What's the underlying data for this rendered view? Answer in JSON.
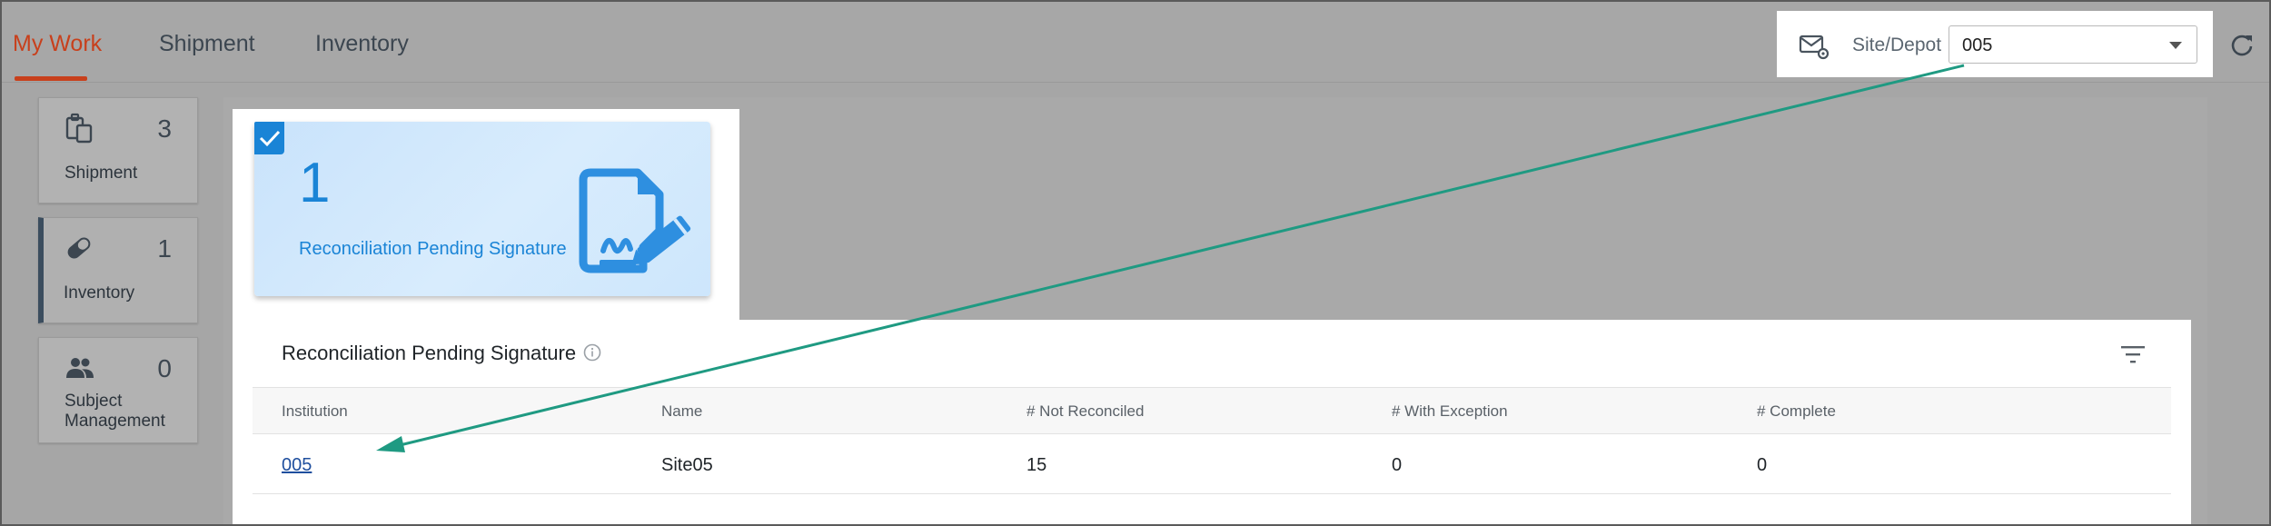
{
  "nav": {
    "tabs": [
      {
        "label": "My Work",
        "active": true
      },
      {
        "label": "Shipment",
        "active": false
      },
      {
        "label": "Inventory",
        "active": false
      }
    ]
  },
  "site_depot": {
    "icon": "mail-settings-icon",
    "label": "Site/Depot",
    "value": "005"
  },
  "sidebar": {
    "items": [
      {
        "icon": "clipboard-copy-icon",
        "count": "3",
        "label": "Shipment",
        "active": false
      },
      {
        "icon": "pill-icon",
        "count": "1",
        "label": "Inventory",
        "active": true
      },
      {
        "icon": "people-icon",
        "count": "0",
        "label_line1": "Subject",
        "label_line2": "Management",
        "active": false
      }
    ]
  },
  "kpi_card": {
    "count": "1",
    "label": "Reconciliation Pending Signature",
    "selected": true,
    "icon": "document-signature-icon"
  },
  "table": {
    "title": "Reconciliation Pending Signature",
    "columns": [
      "Institution",
      "Name",
      "# Not Reconciled",
      "# With Exception",
      "# Complete"
    ],
    "rows": [
      {
        "institution": "005",
        "name": "Site05",
        "not_reconciled": "15",
        "with_exception": "0",
        "complete": "0"
      }
    ]
  },
  "colors": {
    "accent": "#c8401c",
    "primary_blue": "#1a84d6",
    "link": "#1f4f9e",
    "annotation_arrow": "#1f9a82"
  }
}
